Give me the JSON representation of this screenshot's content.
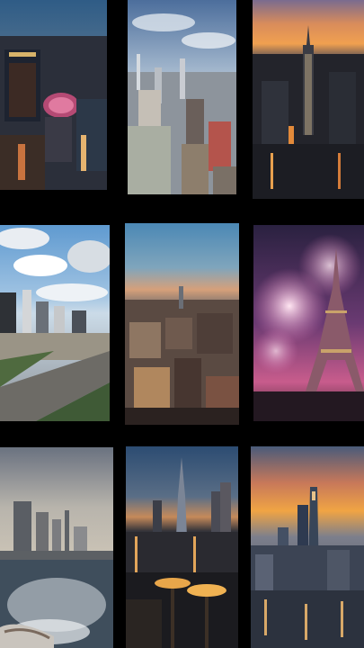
{
  "gallery": {
    "tiles": [
      {
        "subject": "aerial-city-night"
      },
      {
        "subject": "city-skyline-cloudy-day"
      },
      {
        "subject": "city-skyline-sunset"
      },
      {
        "subject": "highway-city-day"
      },
      {
        "subject": "city-dusk-aerial"
      },
      {
        "subject": "eiffel-tower-fireworks"
      },
      {
        "subject": "boat-wake-city-skyline"
      },
      {
        "subject": "terrace-city-night-towers"
      },
      {
        "subject": "skyscrapers-sunset"
      }
    ]
  }
}
